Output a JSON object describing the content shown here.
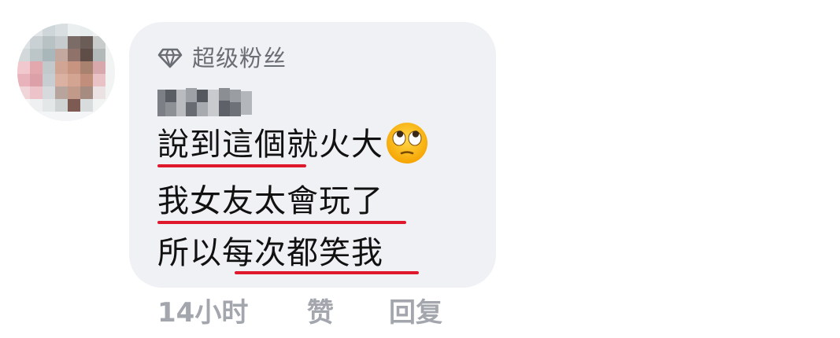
{
  "comment": {
    "badge": {
      "icon": "diamond-icon",
      "label": "超级粉丝"
    },
    "lines": [
      "說到這個就火大",
      "我女友太會玩了",
      "所以每次都笑我"
    ],
    "emoji": "face-with-rolling-eyes-emoji",
    "colors": {
      "bubble": "#f0f1f5",
      "underline": "#e0182c",
      "meta_text": "#a3a6ad",
      "badge_text": "#6a6d74"
    }
  },
  "meta": {
    "time": "14小时",
    "like": "赞",
    "reply": "回复"
  }
}
